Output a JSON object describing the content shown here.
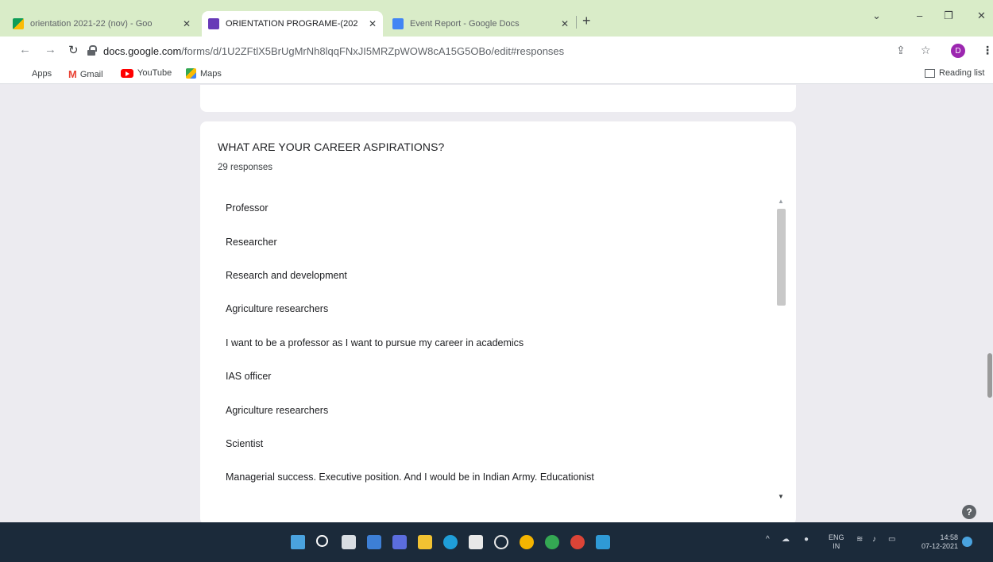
{
  "browser": {
    "tabs": [
      {
        "title": "orientation 2021-22 (nov) - Goo",
        "active": false,
        "close": "✕"
      },
      {
        "title": "ORIENTATION PROGRAME-(202",
        "active": true,
        "close": "✕"
      },
      {
        "title": "Event Report - Google Docs",
        "active": false,
        "close": "✕"
      }
    ],
    "new_tab": "+",
    "url_host": "docs.google.com",
    "url_path": "/forms/d/1U2ZFtlX5BrUgMrNh8lqqFNxJI5MRZpWOW8cA15G5OBo/edit#responses",
    "profile_initial": "D",
    "bookmarks": {
      "apps": "Apps",
      "gmail": "Gmail",
      "youtube": "YouTube",
      "maps": "Maps"
    },
    "reading_list": "Reading list"
  },
  "question": {
    "title": "WHAT ARE YOUR CAREER ASPIRATIONS?",
    "response_count": "29 responses",
    "responses": [
      "Professor",
      "Researcher",
      "Research and development",
      "Agriculture researchers",
      "I want to be a professor as I want to pursue my career in academics",
      "IAS officer",
      "Agriculture researchers",
      "Scientist",
      "Managerial success. Executive position. And I would be in Indian Army. Educationist"
    ]
  },
  "help_icon": "?",
  "taskbar": {
    "lang_line1": "ENG",
    "lang_line2": "IN",
    "time": "14:58",
    "date": "07-12-2021"
  },
  "colors": {
    "tab_strip": "#d9ecc8",
    "taskbar": "#1b2a3a",
    "page_background": "#ecebf0",
    "profile_avatar": "#9c27b0"
  }
}
